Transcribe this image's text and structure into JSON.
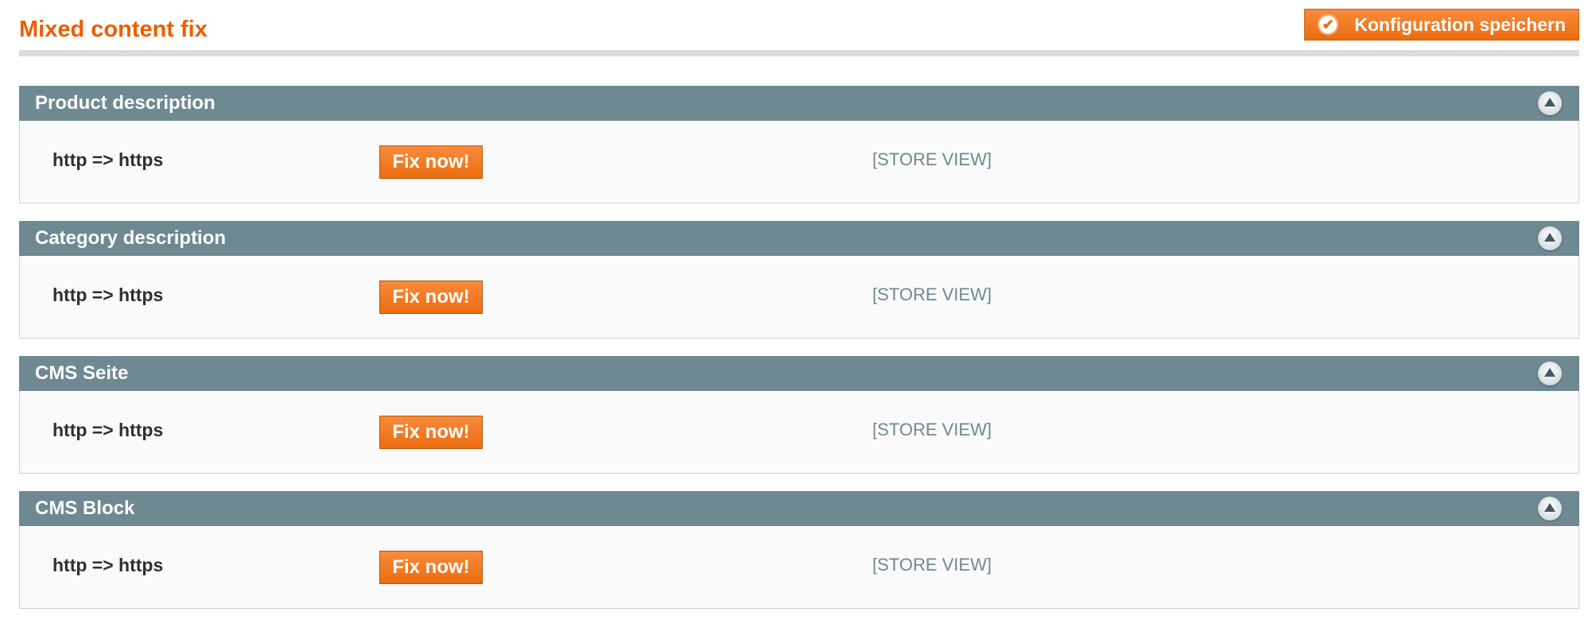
{
  "header": {
    "title": "Mixed content fix",
    "save_label": "Konfiguration speichern"
  },
  "sections": [
    {
      "title": "Product description",
      "row_label": "http => https",
      "button_label": "Fix now!",
      "scope": "[STORE VIEW]"
    },
    {
      "title": "Category description",
      "row_label": "http => https",
      "button_label": "Fix now!",
      "scope": "[STORE VIEW]"
    },
    {
      "title": "CMS Seite",
      "row_label": "http => https",
      "button_label": "Fix now!",
      "scope": "[STORE VIEW]"
    },
    {
      "title": "CMS Block",
      "row_label": "http => https",
      "button_label": "Fix now!",
      "scope": "[STORE VIEW]"
    }
  ],
  "colors": {
    "accent": "#eb5e00",
    "section_header": "#6f8992"
  }
}
